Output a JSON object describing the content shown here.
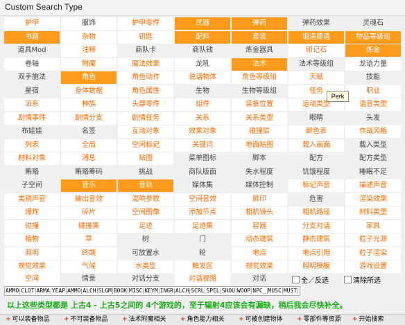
{
  "window": {
    "title": "Custom Search Type"
  },
  "grid_rows": [
    [
      [
        "护甲",
        "w"
      ],
      [
        "服饰",
        "gw"
      ],
      [
        "护甲零件",
        "w"
      ],
      [
        "武器",
        "o"
      ],
      [
        "弹药",
        "o"
      ],
      [
        "弹药效果",
        "g"
      ],
      [
        "灵魂石",
        "g"
      ]
    ],
    [
      [
        "书籍",
        "o"
      ],
      [
        "杂物",
        "w"
      ],
      [
        "钥匙",
        "w"
      ],
      [
        "配料",
        "o"
      ],
      [
        "套装",
        "o"
      ],
      [
        "锻造建造",
        "o"
      ],
      [
        "物品等级组",
        "o"
      ]
    ],
    [
      [
        "道具Mod",
        "g"
      ],
      [
        "注释",
        "w"
      ],
      [
        "商队卡",
        "g"
      ],
      [
        "商队钱",
        "g"
      ],
      [
        "炼金器具",
        "g"
      ],
      [
        "印记石",
        "w"
      ],
      [
        "炼金",
        "o"
      ]
    ],
    [
      [
        "卷轴",
        "gw"
      ],
      [
        "附魔",
        "w"
      ],
      [
        "魔法效果",
        "w"
      ],
      [
        "龙吼",
        "gw"
      ],
      [
        "法术",
        "o"
      ],
      [
        "法术等级组",
        "g"
      ],
      [
        "龙语力量",
        "gw"
      ]
    ],
    [
      [
        "双手施法",
        "g"
      ],
      [
        "角色",
        "o"
      ],
      [
        "角色动作",
        "w"
      ],
      [
        "说话物体",
        "w"
      ],
      [
        "角色等级组",
        "w"
      ],
      [
        "天赋",
        "w"
      ],
      [
        "技能",
        "g"
      ]
    ],
    [
      [
        "星宿",
        "g"
      ],
      [
        "身体数据",
        "w"
      ],
      [
        "角色属性",
        "w"
      ],
      [
        "生物",
        "g"
      ],
      [
        "生物等级组",
        "g"
      ],
      [
        "任务",
        "w"
      ],
      [
        "职业",
        "w"
      ]
    ],
    [
      [
        "派系",
        "w"
      ],
      [
        "种族",
        "w"
      ],
      [
        "头部零件",
        "w"
      ],
      [
        "组件",
        "w"
      ],
      [
        "装备位置",
        "w"
      ],
      [
        "运动类型",
        "w"
      ],
      [
        "语音类型",
        "w"
      ]
    ],
    [
      [
        "剧情事件",
        "w"
      ],
      [
        "剧情分支",
        "w"
      ],
      [
        "剧情任务",
        "w"
      ],
      [
        "关系",
        "w"
      ],
      [
        "关系类型",
        "w"
      ],
      [
        "眼睛",
        "g"
      ],
      [
        "头发",
        "g"
      ]
    ],
    [
      [
        "布娃娃",
        "g"
      ],
      [
        "名签",
        "g"
      ],
      [
        "互动对象",
        "w"
      ],
      [
        "效果对象",
        "w"
      ],
      [
        "碰撞层",
        "w"
      ],
      [
        "颜色表",
        "w"
      ],
      [
        "作战风格",
        "w"
      ]
    ],
    [
      [
        "列表",
        "w"
      ],
      [
        "全局",
        "w"
      ],
      [
        "空闲标记",
        "w"
      ],
      [
        "关键词",
        "w"
      ],
      [
        "地面贴图",
        "w"
      ],
      [
        "载入画面",
        "w"
      ],
      [
        "载入类型",
        "g"
      ]
    ],
    [
      [
        "材料对象",
        "w"
      ],
      [
        "消息",
        "w"
      ],
      [
        "贴图",
        "w"
      ],
      [
        "菜单图标",
        "g"
      ],
      [
        "脚本",
        "g"
      ],
      [
        "配方",
        "g"
      ],
      [
        "配方类型",
        "g"
      ]
    ],
    [
      [
        "贿赂",
        "g"
      ],
      [
        "贿赂筹码",
        "g"
      ],
      [
        "挑战",
        "g"
      ],
      [
        "商队版面",
        "g"
      ],
      [
        "失水程度",
        "g"
      ],
      [
        "饥饿程度",
        "g"
      ],
      [
        "睡眠不足",
        "g"
      ]
    ],
    [
      [
        "子空间",
        "g"
      ],
      [
        "音乐",
        "o"
      ],
      [
        "音轨",
        "o"
      ],
      [
        "媒体集",
        "g"
      ],
      [
        "媒体控制",
        "g"
      ],
      [
        "标记声音",
        "w"
      ],
      [
        "描述声音",
        "w"
      ]
    ],
    [
      [
        "类别声音",
        "w"
      ],
      [
        "输出音效",
        "w"
      ],
      [
        "混响参数",
        "w"
      ],
      [
        "空间音效",
        "w"
      ],
      [
        "脚印",
        "w"
      ],
      [
        "危害",
        "g"
      ],
      [
        "渲染效果",
        "w"
      ]
    ],
    [
      [
        "爆炸",
        "w"
      ],
      [
        "碎片",
        "w"
      ],
      [
        "空间图像",
        "w"
      ],
      [
        "添加节点",
        "w"
      ],
      [
        "相机镜头",
        "w"
      ],
      [
        "相机路径",
        "w"
      ],
      [
        "材料类型",
        "w"
      ]
    ],
    [
      [
        "碰撞",
        "w"
      ],
      [
        "碰撞集",
        "w"
      ],
      [
        "足迹",
        "w"
      ],
      [
        "足迹集",
        "w"
      ],
      [
        "容器",
        "w"
      ],
      [
        "分支对话",
        "w"
      ],
      [
        "家具",
        "w"
      ]
    ],
    [
      [
        "植物",
        "w"
      ],
      [
        "草",
        "w"
      ],
      [
        "树",
        "g"
      ],
      [
        "门",
        "g"
      ],
      [
        "动态建筑",
        "w"
      ],
      [
        "静态建筑",
        "w"
      ],
      [
        "粒子光源",
        "w"
      ]
    ],
    [
      [
        "照明",
        "w"
      ],
      [
        "终端",
        "w"
      ],
      [
        "可放置水",
        "g"
      ],
      [
        "轮",
        "g"
      ],
      [
        "地点",
        "w"
      ],
      [
        "地点引用",
        "w"
      ],
      [
        "粒子渲染",
        "w"
      ]
    ],
    [
      [
        "视觉效果",
        "w"
      ],
      [
        "气候",
        "w"
      ],
      [
        "水类型",
        "w"
      ],
      [
        "触发区",
        "w"
      ],
      [
        "视觉效果",
        "w"
      ],
      [
        "照明模板",
        "w"
      ],
      [
        "游戏设置",
        "w"
      ]
    ]
  ],
  "bottom_row": {
    "cells": [
      [
        "空间",
        "w"
      ],
      [
        "情景",
        "g"
      ],
      [
        "对话分支",
        "g"
      ],
      [
        "对话视图",
        "w"
      ],
      [
        "对话",
        "g"
      ]
    ],
    "select_all_label": "全／反选",
    "clear_label": "清除所选"
  },
  "tooltip": {
    "text": "Perk"
  },
  "tag_bar": [
    "AMMO",
    "CLOT",
    "ARMA",
    "YEAP",
    "AMMO",
    "ALCH",
    "SLGM",
    "BOOK",
    "MISC",
    "KEYM",
    "INGR",
    "ALCH",
    "SCRL",
    "SPEL",
    "SHOU",
    "WOOP",
    "NPC_",
    "MUSC",
    "MUST"
  ],
  "note": {
    "text": "以上这些类型都是 上古4 - 上古5之间的 4个游戏的，至于辐射4应该会有漏缺，稍后我会尽快补全。"
  },
  "toolbar": {
    "items": [
      "可以装备物品",
      "不可装备物品",
      "法术附魔相关",
      "角色能力相关",
      "可被创建物体",
      "零部件等资源",
      "开始搜索"
    ]
  },
  "colors": {
    "accent": "#ff6a00",
    "highlight": "#ff9a1a",
    "note_green": "#1aaa1a"
  }
}
